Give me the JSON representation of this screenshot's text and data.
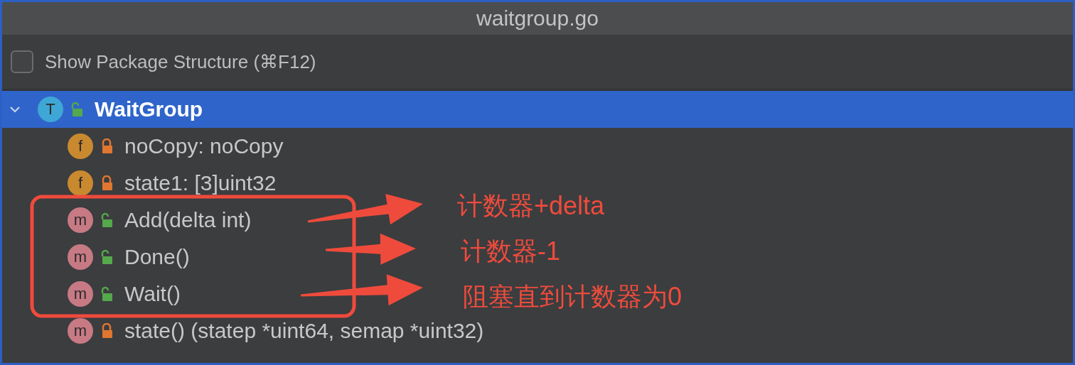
{
  "window": {
    "title": "waitgroup.go"
  },
  "options": [
    {
      "label": "Show Package Structure (⌘F12)",
      "checked": false
    }
  ],
  "tree": [
    {
      "badge": "T",
      "kind": "type",
      "locked": false,
      "label": "WaitGroup",
      "selected": true,
      "expanded": true,
      "children": [
        {
          "badge": "f",
          "kind": "field",
          "locked": true,
          "label": "noCopy: noCopy",
          "selected": false
        },
        {
          "badge": "f",
          "kind": "field",
          "locked": true,
          "label": "state1: [3]uint32",
          "selected": false
        },
        {
          "badge": "m",
          "kind": "method",
          "locked": false,
          "label": "Add(delta int)",
          "selected": false
        },
        {
          "badge": "m",
          "kind": "method",
          "locked": false,
          "label": "Done()",
          "selected": false
        },
        {
          "badge": "m",
          "kind": "method",
          "locked": false,
          "label": "Wait()",
          "selected": false
        },
        {
          "badge": "m",
          "kind": "method",
          "locked": true,
          "label": "state() (statep *uint64, semap *uint32)",
          "selected": false
        }
      ]
    }
  ],
  "annotations": [
    {
      "text": "计数器+delta"
    },
    {
      "text": "计数器-1"
    },
    {
      "text": "阻塞直到计数器为0"
    }
  ]
}
